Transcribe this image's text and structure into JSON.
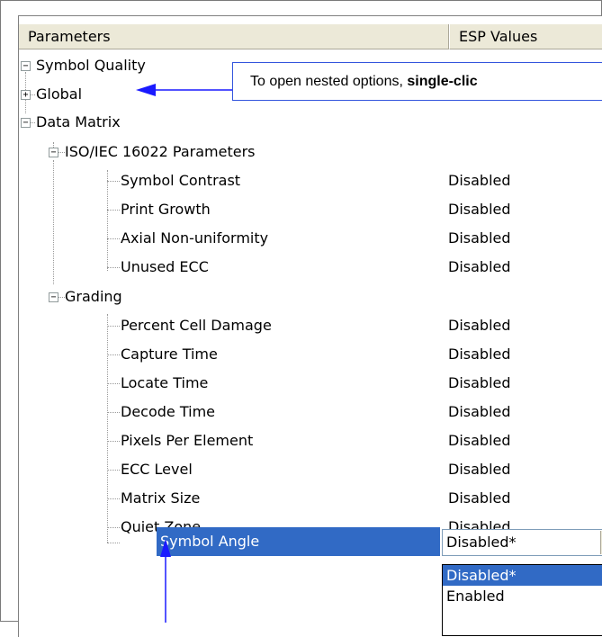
{
  "header": {
    "col_parameters": "Parameters",
    "col_esp_values": "ESP Values"
  },
  "tree": {
    "symbol_quality": "Symbol Quality",
    "global": "Global",
    "data_matrix": "Data Matrix",
    "iso_group": "ISO/IEC 16022 Parameters",
    "iso_items": [
      {
        "label": "Symbol Contrast",
        "value": "Disabled"
      },
      {
        "label": "Print Growth",
        "value": "Disabled"
      },
      {
        "label": "Axial Non-uniformity",
        "value": "Disabled"
      },
      {
        "label": "Unused ECC",
        "value": "Disabled"
      }
    ],
    "grading": "Grading",
    "grading_items": [
      {
        "label": "Percent Cell Damage",
        "value": "Disabled"
      },
      {
        "label": "Capture Time",
        "value": "Disabled"
      },
      {
        "label": "Locate Time",
        "value": "Disabled"
      },
      {
        "label": "Decode Time",
        "value": "Disabled"
      },
      {
        "label": "Pixels Per Element",
        "value": "Disabled"
      },
      {
        "label": "ECC Level",
        "value": "Disabled"
      },
      {
        "label": "Matrix Size",
        "value": "Disabled"
      },
      {
        "label": "Quiet Zone",
        "value": "Disabled"
      }
    ],
    "selected": {
      "label": "Symbol Angle",
      "value": "Disabled*"
    }
  },
  "dropdown": {
    "options": [
      "Disabled*",
      "Enabled"
    ]
  },
  "callout": {
    "text_plain": "To open nested options, ",
    "text_bold": "single-clic"
  },
  "colors": {
    "selection": "#316ac5",
    "callout_arrow": "#1a1aff",
    "header_bg": "#ece9d8"
  }
}
